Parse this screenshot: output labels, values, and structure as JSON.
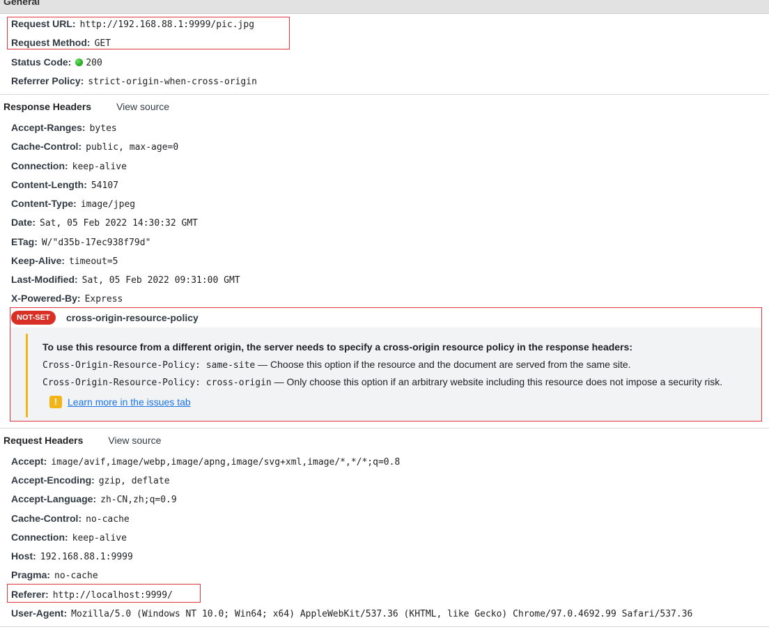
{
  "general": {
    "title": "General",
    "rows": [
      {
        "key": "Request URL:",
        "value": "http://192.168.88.1:9999/pic.jpg"
      },
      {
        "key": "Request Method:",
        "value": "GET"
      },
      {
        "key": "Status Code:",
        "value": "200"
      },
      {
        "key": "Referrer Policy:",
        "value": "strict-origin-when-cross-origin"
      }
    ]
  },
  "response_headers": {
    "title": "Response Headers",
    "view_source": "View source",
    "rows": [
      {
        "key": "Accept-Ranges:",
        "value": "bytes"
      },
      {
        "key": "Cache-Control:",
        "value": "public, max-age=0"
      },
      {
        "key": "Connection:",
        "value": "keep-alive"
      },
      {
        "key": "Content-Length:",
        "value": "54107"
      },
      {
        "key": "Content-Type:",
        "value": "image/jpeg"
      },
      {
        "key": "Date:",
        "value": "Sat, 05 Feb 2022 14:30:32 GMT"
      },
      {
        "key": "ETag:",
        "value": "W/\"d35b-17ec938f79d\""
      },
      {
        "key": "Keep-Alive:",
        "value": "timeout=5"
      },
      {
        "key": "Last-Modified:",
        "value": "Sat, 05 Feb 2022 09:31:00 GMT"
      },
      {
        "key": "X-Powered-By:",
        "value": "Express"
      }
    ],
    "cors": {
      "badge": "NOT-SET",
      "name": "cross-origin-resource-policy",
      "heading": "To use this resource from a different origin, the server needs to specify a cross-origin resource policy in the response headers:",
      "option1_code": "Cross-Origin-Resource-Policy: same-site",
      "option1_text": " — Choose this option if the resource and the document are served from the same site.",
      "option2_code": "Cross-Origin-Resource-Policy: cross-origin",
      "option2_text": " — Only choose this option if an arbitrary website including this resource does not impose a security risk.",
      "warn_icon": "!",
      "learn_more": "Learn more in the issues tab"
    }
  },
  "request_headers": {
    "title": "Request Headers",
    "view_source": "View source",
    "rows": [
      {
        "key": "Accept:",
        "value": "image/avif,image/webp,image/apng,image/svg+xml,image/*,*/*;q=0.8"
      },
      {
        "key": "Accept-Encoding:",
        "value": "gzip, deflate"
      },
      {
        "key": "Accept-Language:",
        "value": "zh-CN,zh;q=0.9"
      },
      {
        "key": "Cache-Control:",
        "value": "no-cache"
      },
      {
        "key": "Connection:",
        "value": "keep-alive"
      },
      {
        "key": "Host:",
        "value": "192.168.88.1:9999"
      },
      {
        "key": "Pragma:",
        "value": "no-cache"
      },
      {
        "key": "Referer:",
        "value": "http://localhost:9999/"
      },
      {
        "key": "User-Agent:",
        "value": "Mozilla/5.0 (Windows NT 10.0; Win64; x64) AppleWebKit/537.36 (KHTML, like Gecko) Chrome/97.0.4692.99 Safari/537.36"
      }
    ]
  },
  "colors": {
    "highlight": "#e0333e",
    "status_ok": "#1aa31a",
    "badge": "#d93025",
    "warning": "#f2b416",
    "link": "#1a73e8"
  }
}
